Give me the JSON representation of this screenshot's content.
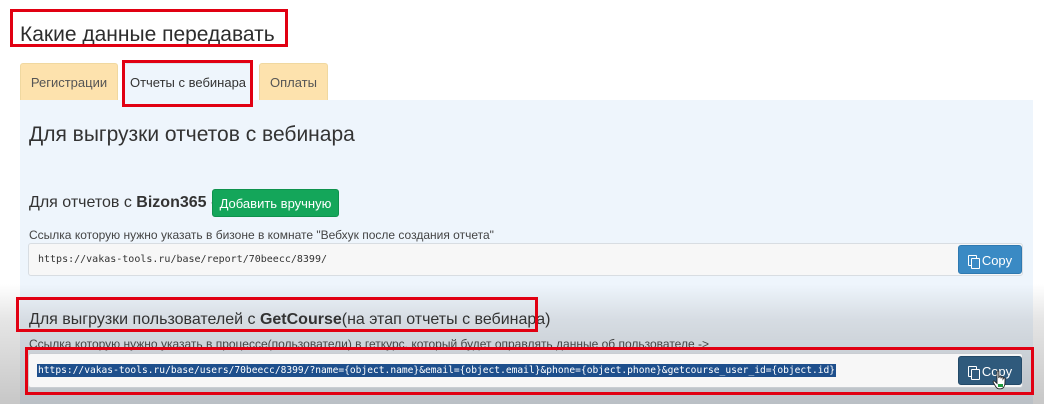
{
  "page": {
    "title": "Какие данные передавать"
  },
  "tabs": [
    {
      "label": "Регистрации",
      "active": false
    },
    {
      "label": "Отчеты с вебинара",
      "active": true
    },
    {
      "label": "Оплаты",
      "active": false
    }
  ],
  "panel": {
    "title": "Для выгрузки отчетов с вебинара",
    "bizon": {
      "prefix": "Для отчетов с ",
      "service": "Bizon365",
      "suffix": " -",
      "add_button": "Добавить вручную",
      "hint": "Ссылка которую нужно указать в бизоне в комнате \"Вебхук после создания отчета\"",
      "url": "https://vakas-tools.ru/base/report/70beecc/8399/",
      "copy_label": "Copy"
    },
    "getcourse": {
      "prefix": "Для выгрузки пользователей с ",
      "service": "GetCourse",
      "suffix": "(на этап отчеты с вебинара)",
      "hint": "Ссылка которую нужно указать в процессе(пользователи) в геткурс, который будет оправлять данные об пользователе ->",
      "url": "https://vakas-tools.ru/base/users/70beecc/8399/?name={object.name}&email={object.email}&phone={object.phone}&getcourse_user_id={object.id}",
      "copy_label": "Copy"
    }
  },
  "colors": {
    "accent_green": "#14a65a",
    "copy_blue": "#3a8ac4",
    "tab_inactive": "#fde2ad",
    "panel_bg": "#eef5fc",
    "annotation_red": "#e10012"
  }
}
